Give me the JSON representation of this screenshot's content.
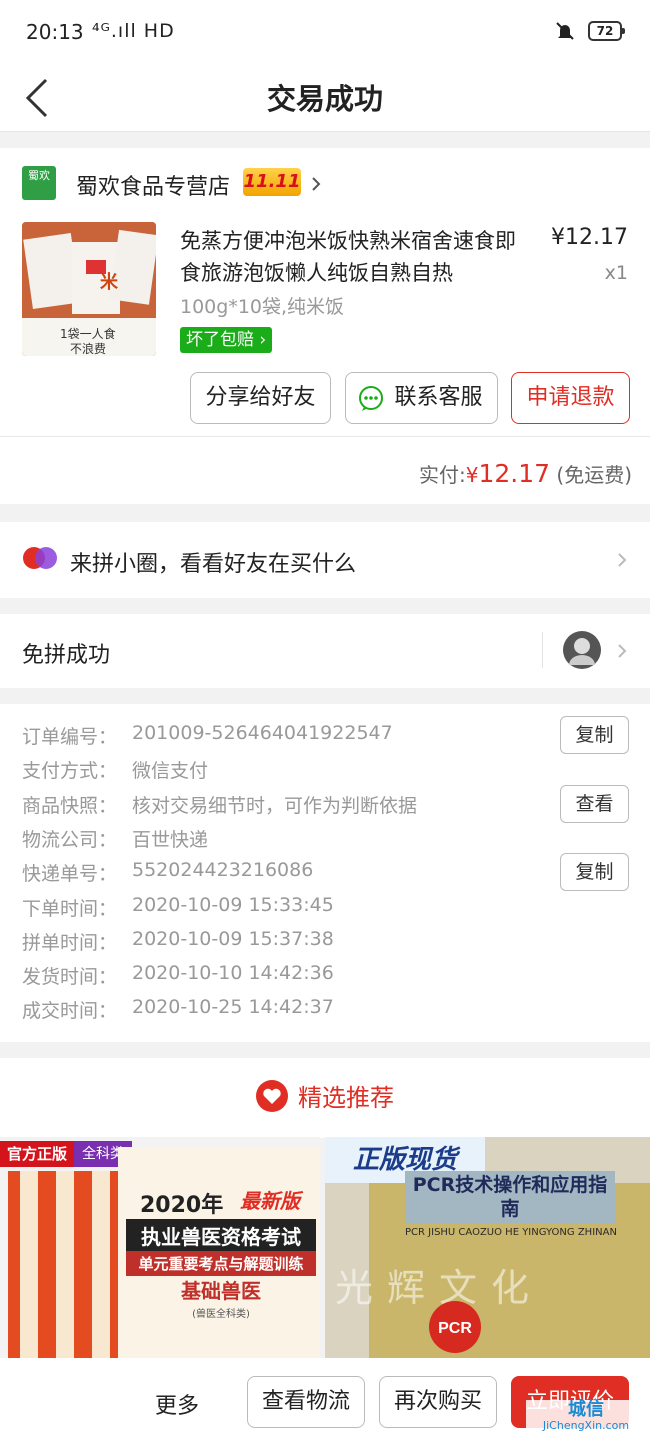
{
  "status_bar": {
    "time": "20:13",
    "network": "⁴ᴳ.ıll HD",
    "battery": "72"
  },
  "header": {
    "title": "交易成功"
  },
  "shop": {
    "logo_text": "蜀欢",
    "name": "蜀欢食品专营店",
    "promo_tag": "11.11"
  },
  "product": {
    "title": "免蒸方便冲泡米饭快熟米宿舍速食即食旅游泡饭懒人纯饭自熟自热",
    "price": "¥12.17",
    "qty": "x1",
    "spec": "100g*10袋,纯米饭",
    "badge": "坏了包赔",
    "image_text_1": "米",
    "image_text_2": "1袋一人食",
    "image_text_3": "不浪费"
  },
  "actions": {
    "share": "分享给好友",
    "contact": "联系客服",
    "refund": "申请退款"
  },
  "payment": {
    "label": "实付:",
    "currency": "¥",
    "amount": "12.17",
    "note": "(免运费)"
  },
  "circle": {
    "text": "来拼小圈，看看好友在买什么"
  },
  "group": {
    "text": "免拼成功"
  },
  "order_info": [
    {
      "label": "订单编号：",
      "value": "201009-526464041922547",
      "action": "复制"
    },
    {
      "label": "支付方式：",
      "value": "微信支付",
      "action": ""
    },
    {
      "label": "商品快照：",
      "value": "核对交易细节时，可作为判断依据",
      "action": "查看"
    },
    {
      "label": "物流公司：",
      "value": "百世快递",
      "action": ""
    },
    {
      "label": "快递单号：",
      "value": "552024423216086",
      "action": "复制"
    },
    {
      "label": "下单时间：",
      "value": "2020-10-09 15:33:45",
      "action": ""
    },
    {
      "label": "拼单时间：",
      "value": "2020-10-09 15:37:38",
      "action": ""
    },
    {
      "label": "发货时间：",
      "value": "2020-10-10 14:42:36",
      "action": ""
    },
    {
      "label": "成交时间：",
      "value": "2020-10-25 14:42:37",
      "action": ""
    }
  ],
  "recommend": {
    "title": "精选推荐",
    "book1": {
      "tag1": "官方正版",
      "tag2": "全科类",
      "year": "2020年",
      "edition": "最新版",
      "title": "执业兽医资格考试",
      "subtitle": "单元重要考点与解题训练",
      "subject": "基础兽医",
      "note": "(兽医全科类)"
    },
    "book2": {
      "tag": "正版现货",
      "title": "PCR技术操作和应用指南",
      "pinyin": "PCR JISHU CAOZUO HE YINGYONG ZHINAN",
      "overlay": "光辉文化"
    }
  },
  "bottom_bar": {
    "more": "更多",
    "logistics": "查看物流",
    "rebuy": "再次购买",
    "review": "立即评价"
  },
  "watermark": {
    "line1": "城信",
    "line2": "JiChengXin.com"
  },
  "colors": {
    "accent": "#e02e24",
    "green": "#1aac19",
    "background": "#f2f2f2"
  }
}
